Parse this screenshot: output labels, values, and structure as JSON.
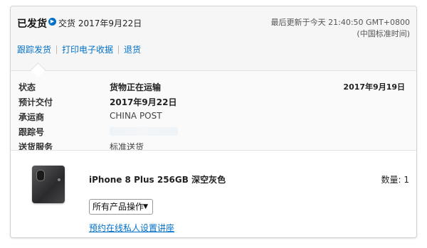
{
  "header": {
    "status": "已发货",
    "status_icon": "info-circle-icon",
    "status_detail": "交货 2017年9月22日",
    "updated": "最后更新于今天 21:40:50 GMT+0800 (中国标准时间)",
    "links": [
      "跟踪发货",
      "打印电子收据",
      "退货"
    ]
  },
  "shipment": {
    "rows": [
      {
        "label": "状态",
        "value": "货物正在运输",
        "date": "2017年9月19日"
      },
      {
        "label": "预计交付",
        "value": "2017年9月22日"
      },
      {
        "label": "承运商",
        "value": "CHINA POST"
      },
      {
        "label": "跟踪号",
        "value": ""
      },
      {
        "label": "送货服务",
        "value": "标准送货"
      }
    ]
  },
  "product": {
    "name": "iPhone 8 Plus 256GB 深空灰色",
    "quantity": "数量: 1",
    "actions_select": "所有产品操作",
    "seminar_link": "预约在线私人设置讲座"
  },
  "colors": {
    "link": "#0070c9",
    "header_bg": "#f6f6f6"
  }
}
